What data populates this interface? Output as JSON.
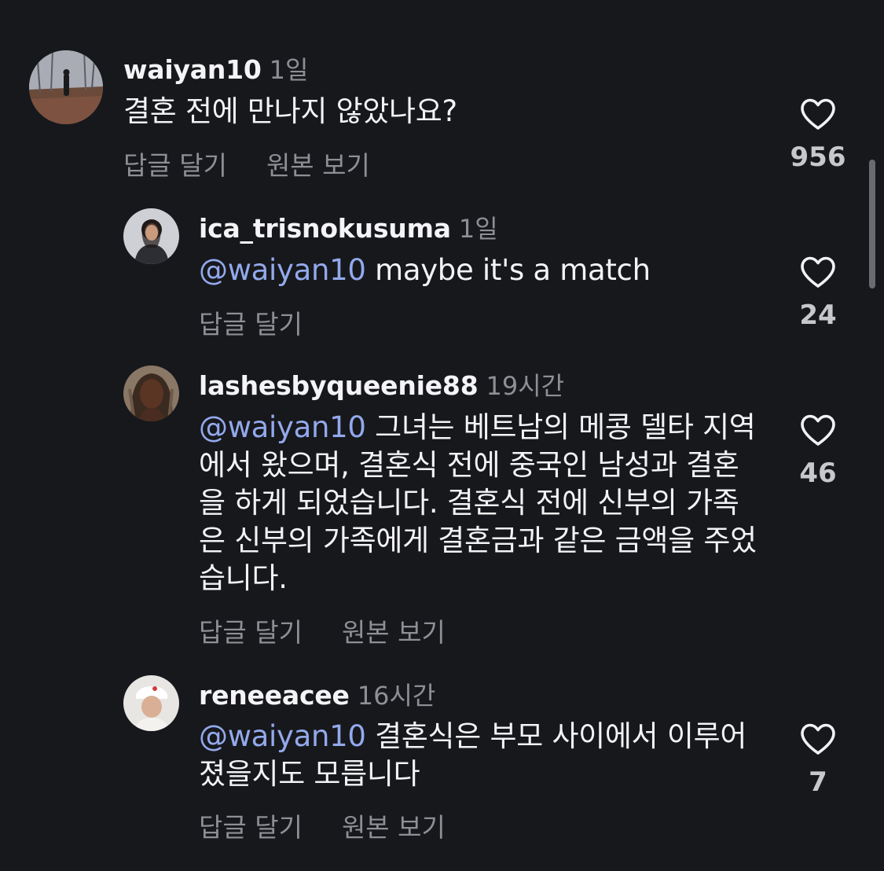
{
  "comments": [
    {
      "username": "waiyan10",
      "time": "1일",
      "mention": "",
      "text": "결혼 전에 만나지 않았나요?",
      "reply_label": "답글 달기",
      "translate_label": "원본 보기",
      "likes": "956"
    },
    {
      "username": "ica_trisnokusuma",
      "time": "1일",
      "mention": "@waiyan10",
      "text": "maybe it's a match",
      "reply_label": "답글 달기",
      "translate_label": "",
      "likes": "24"
    },
    {
      "username": "lashesbyqueenie88",
      "time": "19시간",
      "mention": "@waiyan10",
      "text": "그녀는 베트남의 메콩 델타 지역에서 왔으며, 결혼식 전에 중국인 남성과 결혼을 하게 되었습니다. 결혼식 전에 신부의 가족은 신부의 가족에게 결혼금과 같은 금액을 주었습니다.",
      "reply_label": "답글 달기",
      "translate_label": "원본 보기",
      "likes": "46"
    },
    {
      "username": "reneeacee",
      "time": "16시간",
      "mention": "@waiyan10",
      "text": "결혼식은 부모 사이에서 이루어졌을지도 모릅니다",
      "reply_label": "답글 달기",
      "translate_label": "원본 보기",
      "likes": "7"
    }
  ],
  "colors": {
    "background": "#17181c",
    "mention": "#93a9ec",
    "secondary_text": "#8d8f95"
  },
  "icons": {
    "like": "heart-outline-icon"
  }
}
